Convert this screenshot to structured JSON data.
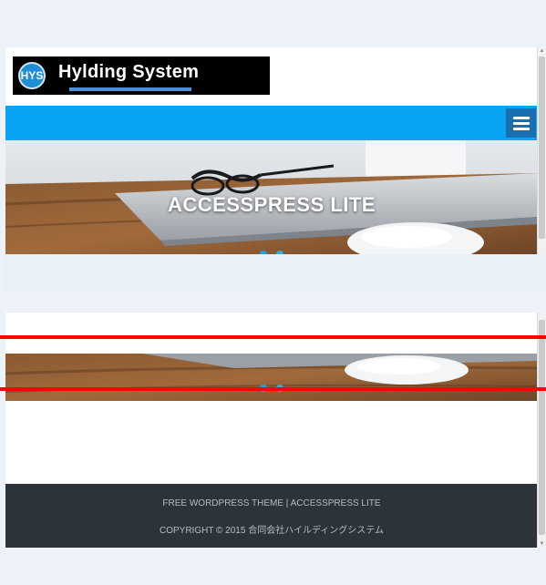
{
  "site": {
    "logo_badge": "HYS",
    "logo_title": "Hylding System"
  },
  "hero": {
    "title": "ACCESSPRESS LITE"
  },
  "footer": {
    "line1": "FREE WORDPRESS THEME | ACCESSPRESS LITE",
    "line2": "COPYRIGHT © 2015 合同会社ハイルディングシステム"
  },
  "colors": {
    "nav_blue": "#08a5f4",
    "menu_button": "#1a6fb1",
    "footer_bg": "#2c333b",
    "marker_red": "#ff0000"
  },
  "icons": {
    "menu": "hamburger-icon"
  }
}
